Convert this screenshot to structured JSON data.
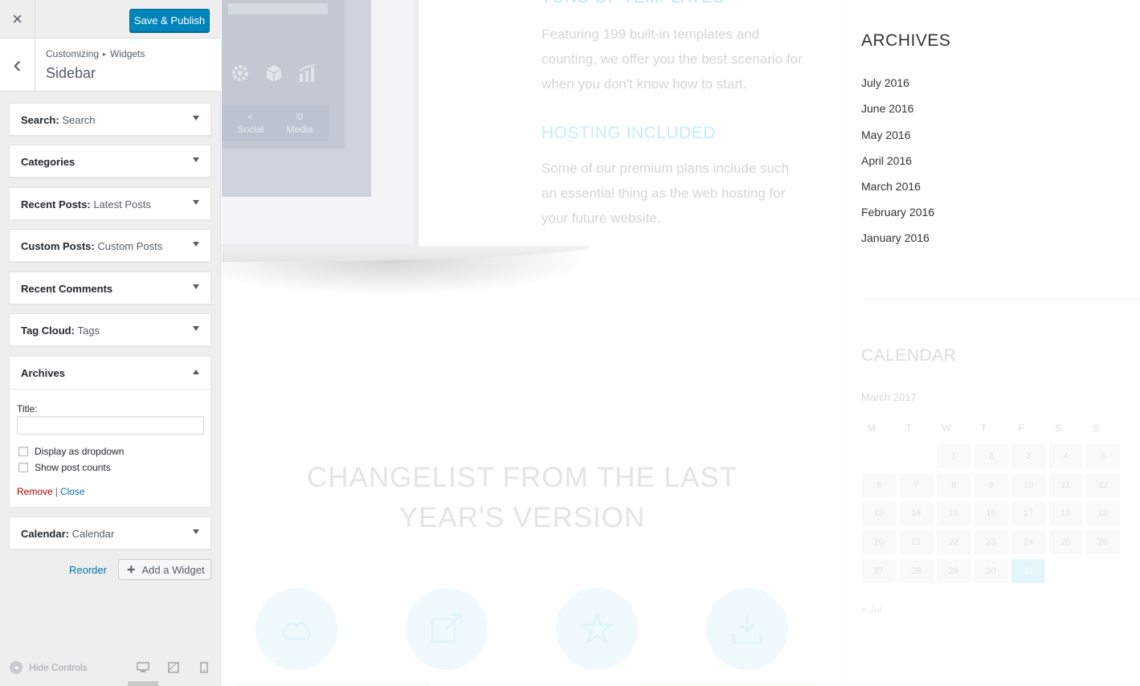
{
  "customizer": {
    "close_icon": "×",
    "publish_label": "Save & Publish",
    "back_icon": "‹",
    "breadcrumb": [
      "Customizing",
      "Widgets"
    ],
    "breadcrumb_sep": "▸",
    "panel_title": "Sidebar",
    "widgets": [
      {
        "title": "Search",
        "sub": "Search"
      },
      {
        "title": "Categories",
        "sub": ""
      },
      {
        "title": "Recent Posts",
        "sub": "Latest Posts"
      },
      {
        "title": "Custom Posts",
        "sub": "Custom Posts"
      },
      {
        "title": "Recent Comments",
        "sub": ""
      },
      {
        "title": "Tag Cloud",
        "sub": "Tags"
      }
    ],
    "archives_widget": {
      "title": "Archives",
      "field_label": "Title:",
      "field_value": "",
      "checkbox_dropdown": "Display as dropdown",
      "checkbox_counts": "Show post counts",
      "remove_label": "Remove",
      "sep": "|",
      "close_label": "Close"
    },
    "calendar_widget": {
      "title": "Calendar",
      "sub": "Calendar"
    },
    "reorder_label": "Reorder",
    "add_widget_label": "Add a Widget",
    "hide_controls_label": "Hide Controls"
  },
  "preview": {
    "device_tabs": [
      "Social",
      "Media"
    ],
    "tons_title": "TONS OF TEMPLATES",
    "tons_text": "Featuring 199 built-in templates and counting, we offer you the best scenario for when you don't know how to start.",
    "hosting_title": "HOSTING INCLUDED",
    "hosting_text": "Some of our premium plans include such an essential thing as the web hosting for your future website.",
    "changelist_title": "CHANGELIST FROM THE LAST YEAR'S VERSION",
    "archives_heading": "ARCHIVES",
    "archives": [
      "July 2016",
      "June 2016",
      "May 2016",
      "April 2016",
      "March 2016",
      "February 2016",
      "January 2016"
    ],
    "calendar_heading": "CALENDAR",
    "calendar_caption": "March 2017",
    "calendar_days": [
      "M",
      "T",
      "W",
      "T",
      "F",
      "S",
      "S"
    ],
    "calendar_rows": [
      [
        "",
        "",
        "1",
        "2",
        "3",
        "4",
        "5"
      ],
      [
        "6",
        "7",
        "8",
        "9",
        "10",
        "11",
        "12"
      ],
      [
        "13",
        "14",
        "15",
        "16",
        "17",
        "18",
        "19"
      ],
      [
        "20",
        "21",
        "22",
        "23",
        "24",
        "25",
        "26"
      ],
      [
        "27",
        "28",
        "29",
        "30",
        "31",
        "",
        ""
      ]
    ],
    "calendar_today": "31",
    "calendar_prev": "« Jul"
  },
  "colors": {
    "primary_button": "#0085ba",
    "link": "#0073aa",
    "remove_link": "#aa0000",
    "accent_light": "#b8e6f5"
  }
}
